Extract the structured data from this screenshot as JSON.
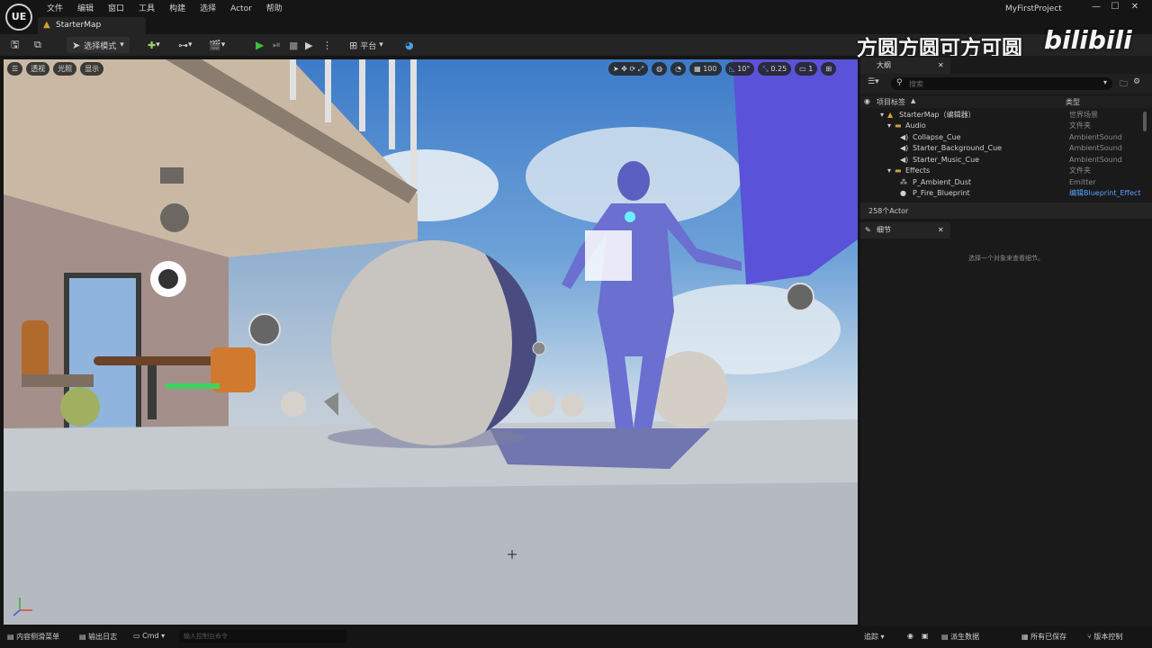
{
  "app": {
    "logo": "UE",
    "project_name": "MyFirstProject",
    "map_tab": "StarterMap"
  },
  "menu": [
    "文件",
    "编辑",
    "窗口",
    "工具",
    "构建",
    "选择",
    "Actor",
    "帮助"
  ],
  "window_controls": [
    "—",
    "☐",
    "✕"
  ],
  "toolbar": {
    "select_mode": "选择模式",
    "platform": "平台"
  },
  "watermark": {
    "text": "方圆方圆可方可圆",
    "logo": "bilibili"
  },
  "viewport": {
    "buttons": [
      "透视",
      "光照",
      "显示"
    ],
    "grid_snap": "100",
    "rotate_snap": "10°",
    "scale_snap": "0.25",
    "camera_speed": "1",
    "crosshair": "+"
  },
  "outliner": {
    "tab": "大纲",
    "search_placeholder": "搜索",
    "col_label": "项目标签",
    "col_type": "类型",
    "rows": [
      {
        "name": "StarterMap（编辑器）",
        "type": "世界场景",
        "icon": "map-icon"
      },
      {
        "name": "Audio",
        "type": "文件夹",
        "icon": "folder-icon"
      },
      {
        "name": "Collapse_Cue",
        "type": "AmbientSound",
        "icon": "sound-icon"
      },
      {
        "name": "Starter_Background_Cue",
        "type": "AmbientSound",
        "icon": "sound-icon"
      },
      {
        "name": "Starter_Music_Cue",
        "type": "AmbientSound",
        "icon": "sound-icon"
      },
      {
        "name": "Effects",
        "type": "文件夹",
        "icon": "folder-icon"
      },
      {
        "name": "P_Ambient_Dust",
        "type": "Emitter",
        "icon": "emitter-icon"
      },
      {
        "name": "P_Fire_Blueprint",
        "type": "编辑Blueprint_Effect",
        "icon": "blueprint-icon"
      }
    ],
    "actor_count": "258个Actor"
  },
  "details": {
    "tab": "细节",
    "empty_hint": "选择一个对象来查看细节。"
  },
  "statusbar": {
    "content_drawer": "内容侧滑菜单",
    "output_log": "输出日志",
    "cmd": "Cmd",
    "console_placeholder": "输入控制台命令",
    "trace": "追踪",
    "derived_data": "派生数据",
    "all_saved": "所有已保存",
    "source_control": "版本控制"
  },
  "colors": {
    "accent_play": "#3fbf3f",
    "link_blue": "#5aa0ff",
    "panel_bg": "#1a1a1a"
  }
}
